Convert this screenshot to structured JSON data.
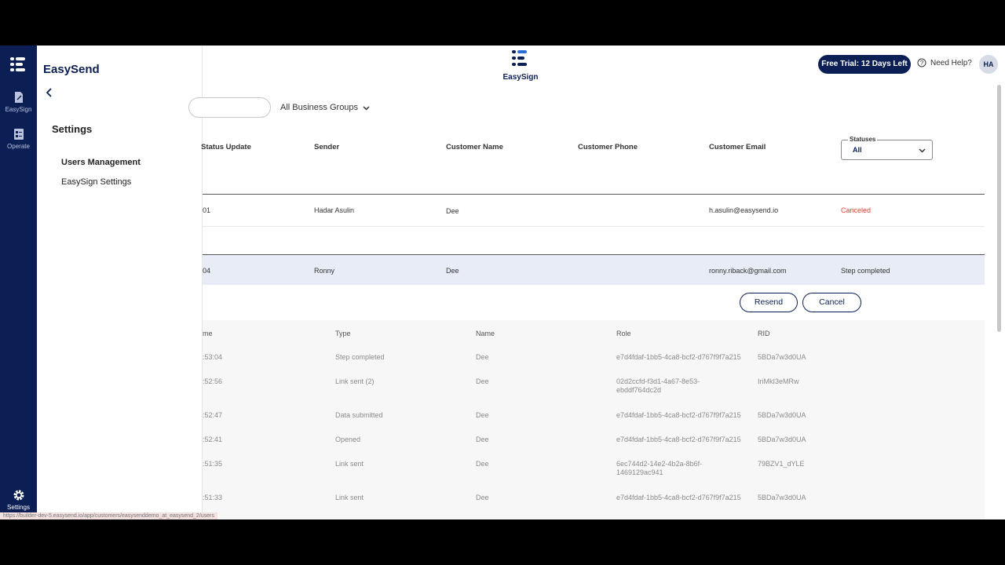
{
  "rail": {
    "easysign_label": "EasySign",
    "operate_label": "Operate",
    "settings_label": "Settings"
  },
  "panel": {
    "brand": "EasySend",
    "title": "Settings",
    "items": [
      {
        "label": "Users Management"
      },
      {
        "label": "EasySign Settings"
      }
    ]
  },
  "topbar": {
    "logo_text": "EasySign",
    "trial": "Free Trial: 12 Days Left",
    "help": "Need Help?",
    "avatar": "HA"
  },
  "filters": {
    "business_groups": "All Business Groups"
  },
  "table": {
    "headers": [
      "Status Update",
      "Sender",
      "Customer Name",
      "Customer Phone",
      "Customer Email"
    ],
    "status_filter_label": "Statuses",
    "status_filter_value": "All",
    "rows": [
      {
        "status_update": "01",
        "sender": "Hadar Asulin",
        "customer_name": "Dee",
        "customer_phone": "",
        "customer_email": "h.asulin@easysend.io",
        "status": "Canceled"
      },
      {
        "status_update": "04",
        "sender": "Ronny",
        "customer_name": "Dee",
        "customer_phone": "",
        "customer_email": "ronny.riback@gmail.com",
        "status": "Step completed"
      }
    ],
    "resend_label": "Resend",
    "cancel_label": "Cancel"
  },
  "subtable": {
    "headers": [
      "me",
      "Type",
      "Name",
      "Role",
      "RID"
    ],
    "rows": [
      {
        "time": ":53:04",
        "type": "Step completed",
        "name": "Dee",
        "role": "e7d4fdaf-1bb5-4ca8-bcf2-d767f9f7a215",
        "rid": "5BDa7w3d0UA"
      },
      {
        "time": ":52:56",
        "type": "Link sent (2)",
        "name": "Dee",
        "role": "02d2ccfd-f3d1-4a67-8e53-ebddf764dc2d",
        "rid": "IriMkI3eMRw"
      },
      {
        "time": ":52:47",
        "type": "Data submitted",
        "name": "Dee",
        "role": "e7d4fdaf-1bb5-4ca8-bcf2-d767f9f7a215",
        "rid": "5BDa7w3d0UA"
      },
      {
        "time": ":52:41",
        "type": "Opened",
        "name": "Dee",
        "role": "e7d4fdaf-1bb5-4ca8-bcf2-d767f9f7a215",
        "rid": "5BDa7w3d0UA"
      },
      {
        "time": ":51:35",
        "type": "Link sent",
        "name": "Dee",
        "role": "6ec744d2-14e2-4b2a-8b6f-1469129ac941",
        "rid": "79BZV1_dYLE"
      },
      {
        "time": ":51:33",
        "type": "Link sent",
        "name": "Dee",
        "role": "e7d4fdaf-1bb5-4ca8-bcf2-d767f9f7a215",
        "rid": "5BDa7w3d0UA"
      }
    ]
  },
  "status_url": "https://builder-dev-5.easysend.io/app/customers/easysenddemo_at_easysend_2/users",
  "colors": {
    "navy": "#0b1f55",
    "canceled": "#d9432f",
    "selected_row": "#e8ecf7"
  }
}
